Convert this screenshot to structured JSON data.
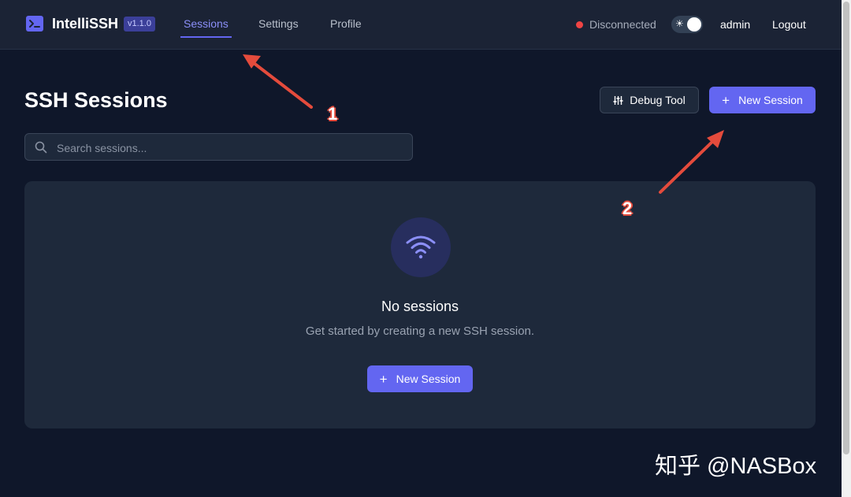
{
  "header": {
    "app_name": "IntelliSSH",
    "version": "v1.1.0",
    "nav": [
      {
        "label": "Sessions",
        "active": true
      },
      {
        "label": "Settings",
        "active": false
      },
      {
        "label": "Profile",
        "active": false
      }
    ],
    "status": {
      "text": "Disconnected",
      "color": "#ef4444"
    },
    "theme_toggle": {
      "icon": "sun-icon"
    },
    "user": "admin",
    "logout_label": "Logout"
  },
  "page": {
    "title": "SSH Sessions",
    "debug_button_label": "Debug Tool",
    "new_session_label": "New Session",
    "search_placeholder": "Search sessions..."
  },
  "empty_state": {
    "icon": "wifi-icon",
    "title": "No sessions",
    "subtitle": "Get started by creating a new SSH session.",
    "button_label": "New Session"
  },
  "annotations": [
    {
      "label": "1"
    },
    {
      "label": "2"
    }
  ],
  "watermark": "知乎 @NASBox",
  "colors": {
    "accent": "#6366f1",
    "background": "#0f172a",
    "card": "#1e293b",
    "arrow": "#e44b3c"
  }
}
